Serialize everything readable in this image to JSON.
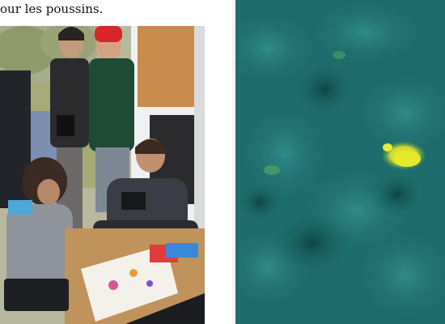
{
  "article": {
    "caption_fragment": "our les poussins."
  },
  "images": [
    {
      "name": "field-team-photo",
      "alt": ""
    },
    {
      "name": "aerial-thermal-photo",
      "alt": ""
    }
  ],
  "colors": {
    "thermal_canopy": "#1e6d6d",
    "thermal_hotspot": "#e5ea2a",
    "van_white": "#eef0f1",
    "hat_red": "#d8262a",
    "jacket_green": "#1f4a35"
  }
}
